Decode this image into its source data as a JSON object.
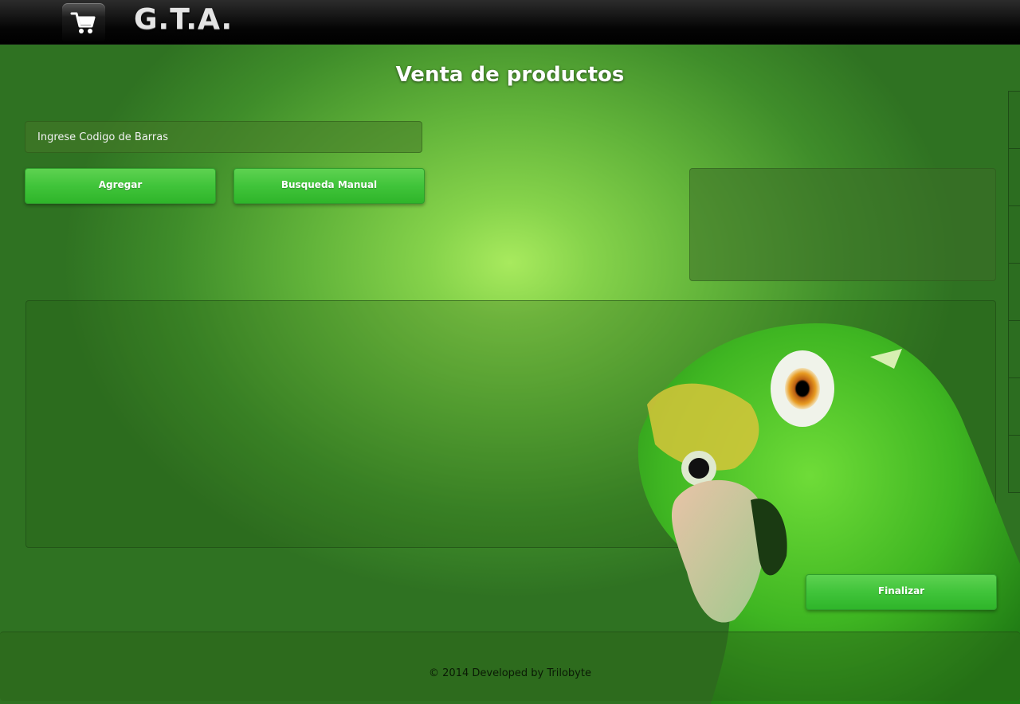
{
  "header": {
    "brand": "G.T.A.",
    "cart_icon": "shopping-cart-icon"
  },
  "main": {
    "title": "Venta de productos",
    "barcode_placeholder": "Ingrese Codigo de Barras",
    "barcode_value": "",
    "agregar_label": "Agregar",
    "busqueda_label": "Busqueda Manual",
    "finalizar_label": "Finalizar"
  },
  "footer": {
    "text": "© 2014 Developed by Trilobyte"
  },
  "colors": {
    "accent_button": "#40c43a",
    "background": "#62b43a",
    "topbar": "#000000"
  }
}
